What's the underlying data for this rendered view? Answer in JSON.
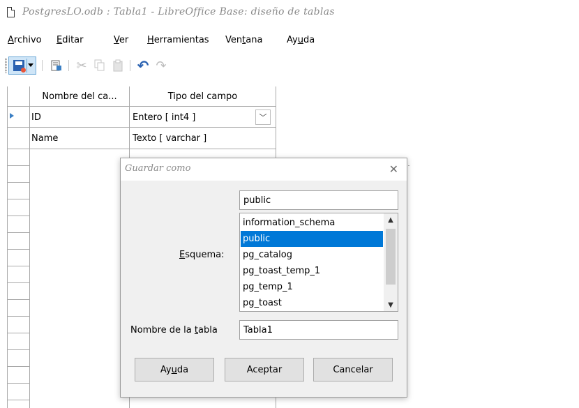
{
  "window": {
    "title": "PostgresLO.odb : Tabla1 - LibreOffice Base: diseño de tablas"
  },
  "menu": {
    "items": [
      {
        "label": "Archivo",
        "mnemonic": "A",
        "rest": "rchivo"
      },
      {
        "label": "Editar",
        "mnemonic": "E",
        "rest": "ditar"
      },
      {
        "label": "Ver",
        "mnemonic": "V",
        "rest": "er"
      },
      {
        "label": "Herramientas",
        "mnemonic": "H",
        "rest": "erramientas"
      },
      {
        "label": "Ventana",
        "pre": "Ven",
        "mnemonic": "t",
        "rest": "ana"
      },
      {
        "label": "Ayuda",
        "pre": "Ay",
        "mnemonic": "u",
        "rest": "da"
      }
    ]
  },
  "toolbar": {
    "icons": [
      "save-icon",
      "index-design-icon",
      "cut-icon",
      "copy-icon",
      "paste-icon",
      "undo-icon",
      "redo-icon"
    ],
    "cut_glyph": "✂",
    "copy_glyph": "⧉",
    "paste_glyph": "📋",
    "undo_glyph": "↶",
    "redo_glyph": "↷"
  },
  "table_design": {
    "columns": [
      "Nombre del ca...",
      "Tipo del campo"
    ],
    "rows": [
      {
        "name": "ID",
        "type": "Entero [ int4 ]"
      },
      {
        "name": "Name",
        "type": "Texto [ varchar ]"
      }
    ],
    "combo_arrow": "﹀"
  },
  "dialog": {
    "title": "Guardar como",
    "close_glyph": "✕",
    "schema_label_pre": "",
    "schema_label_mnemonic": "E",
    "schema_label_rest": "squema:",
    "schema_value": "public",
    "schema_options": [
      "information_schema",
      "public",
      "pg_catalog",
      "pg_toast_temp_1",
      "pg_temp_1",
      "pg_toast"
    ],
    "selected_option": "public",
    "table_name_label_pre": "Nombre de la ",
    "table_name_label_mnemonic": "t",
    "table_name_label_rest": "abla",
    "table_name_value": "Tabla1",
    "buttons": {
      "help_pre": "Ay",
      "help_mnemonic": "u",
      "help_rest": "da",
      "accept": "Aceptar",
      "cancel": "Cancelar"
    },
    "scroll_up": "▲",
    "scroll_down": "▼"
  }
}
